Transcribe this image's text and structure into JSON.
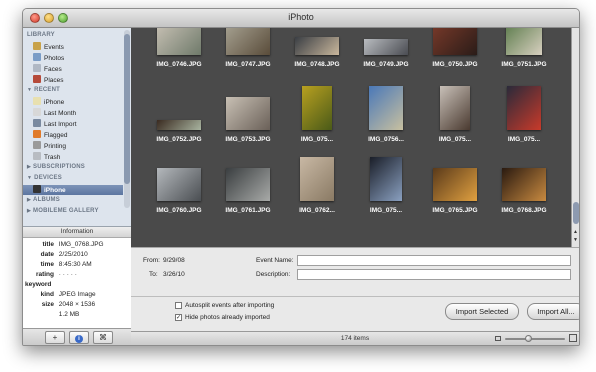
{
  "window": {
    "title": "iPhoto"
  },
  "sidebar": {
    "sections": [
      {
        "label": "LIBRARY",
        "items": [
          {
            "label": "Events",
            "icon": "events-icon",
            "color": "#c8a24a"
          },
          {
            "label": "Photos",
            "icon": "photos-icon",
            "color": "#7a9cc6"
          },
          {
            "label": "Faces",
            "icon": "faces-icon",
            "color": "#b0b8c4"
          },
          {
            "label": "Places",
            "icon": "places-icon",
            "color": "#b54a3a"
          }
        ]
      },
      {
        "label": "RECENT",
        "items": [
          {
            "label": "iPhone",
            "icon": "album-icon",
            "color": "#e8e0b0"
          },
          {
            "label": "Last Month",
            "icon": "calendar-icon",
            "color": "#d8d8d8"
          },
          {
            "label": "Last Import",
            "icon": "import-icon",
            "color": "#7a8aa0"
          },
          {
            "label": "Flagged",
            "icon": "flag-icon",
            "color": "#e07a2a"
          },
          {
            "label": "Printing",
            "icon": "printer-icon",
            "color": "#9a9a9a"
          },
          {
            "label": "Trash",
            "icon": "trash-icon",
            "color": "#b8bcc2"
          }
        ]
      },
      {
        "label": "SUBSCRIPTIONS",
        "items": []
      },
      {
        "label": "DEVICES",
        "items": [
          {
            "label": "iPhone",
            "icon": "iphone-icon",
            "color": "#333333"
          }
        ]
      },
      {
        "label": "ALBUMS",
        "items": []
      },
      {
        "label": "MOBILEME GALLERY",
        "items": []
      }
    ]
  },
  "info": {
    "header": "Information",
    "rows": [
      {
        "key": "title",
        "value": "IMG_0768.JPG"
      },
      {
        "key": "date",
        "value": "2/25/2010"
      },
      {
        "key": "time",
        "value": "8:45:30 AM"
      },
      {
        "key": "rating",
        "value": "· · · · ·"
      },
      {
        "key": "keyword",
        "value": ""
      },
      {
        "key": "kind",
        "value": "JPEG Image"
      },
      {
        "key": "size",
        "value": "2048 × 1536"
      },
      {
        "key": "",
        "value": "1.2 MB"
      }
    ]
  },
  "sidebar_buttons": {
    "add": "+",
    "info": "i",
    "slideshow": "⌘"
  },
  "photos": [
    {
      "name": "IMG_0746.JPG",
      "colors": [
        "#c9c2b6",
        "#6f7a6a"
      ]
    },
    {
      "name": "IMG_0747.JPG",
      "colors": [
        "#a8a494",
        "#5a4c3a"
      ]
    },
    {
      "name": "IMG_0748.JPG",
      "colors": [
        "#3a3e44",
        "#c9b79c"
      ]
    },
    {
      "name": "IMG_0749.JPG",
      "colors": [
        "#b9bcc0",
        "#4a4c52"
      ]
    },
    {
      "name": "IMG_0750.JPG",
      "colors": [
        "#7a3a2a",
        "#2a1c18"
      ]
    },
    {
      "name": "IMG_0751.JPG",
      "colors": [
        "#5a7a4a",
        "#d8d0c0"
      ]
    },
    {
      "name": "IMG_0752.JPG",
      "colors": [
        "#3a2a20",
        "#a8b4a0"
      ]
    },
    {
      "name": "IMG_0753.JPG",
      "colors": [
        "#c8c0b4",
        "#6a6058"
      ]
    },
    {
      "name": "IMG_075...",
      "colors": [
        "#b8a020",
        "#4a5a18"
      ]
    },
    {
      "name": "IMG_0756...",
      "colors": [
        "#4a78b8",
        "#c8c0a0"
      ]
    },
    {
      "name": "IMG_075...",
      "colors": [
        "#c8c0b8",
        "#4a3a30"
      ]
    },
    {
      "name": "IMG_075...",
      "colors": [
        "#2a2a3a",
        "#c83a2a"
      ]
    },
    {
      "name": "IMG_0760.JPG",
      "colors": [
        "#b4b8bc",
        "#4a4e52"
      ]
    },
    {
      "name": "IMG_0761.JPG",
      "colors": [
        "#3a3e40",
        "#a8aaa8"
      ]
    },
    {
      "name": "IMG_0762...",
      "colors": [
        "#c8b8a4",
        "#8a7a64"
      ]
    },
    {
      "name": "IMG_075...",
      "colors": [
        "#1a1e28",
        "#8aa0c0"
      ]
    },
    {
      "name": "IMG_0765.JPG",
      "colors": [
        "#5a3a1a",
        "#e0a040"
      ]
    },
    {
      "name": "IMG_0768.JPG",
      "colors": [
        "#2a1a10",
        "#c88a40"
      ]
    }
  ],
  "import": {
    "from_label": "From:",
    "from_value": "9/29/08",
    "to_label": "To:",
    "to_value": "3/26/10",
    "event_name_label": "Event Name:",
    "event_name_value": "",
    "description_label": "Description:",
    "description_value": "",
    "autosplit_label": "Autosplit events after importing",
    "autosplit_checked": false,
    "hide_label": "Hide photos already imported",
    "hide_checked": true,
    "import_selected": "Import Selected",
    "import_all": "Import All..."
  },
  "status": {
    "count": "174 items",
    "zoom_level": 0.38
  }
}
